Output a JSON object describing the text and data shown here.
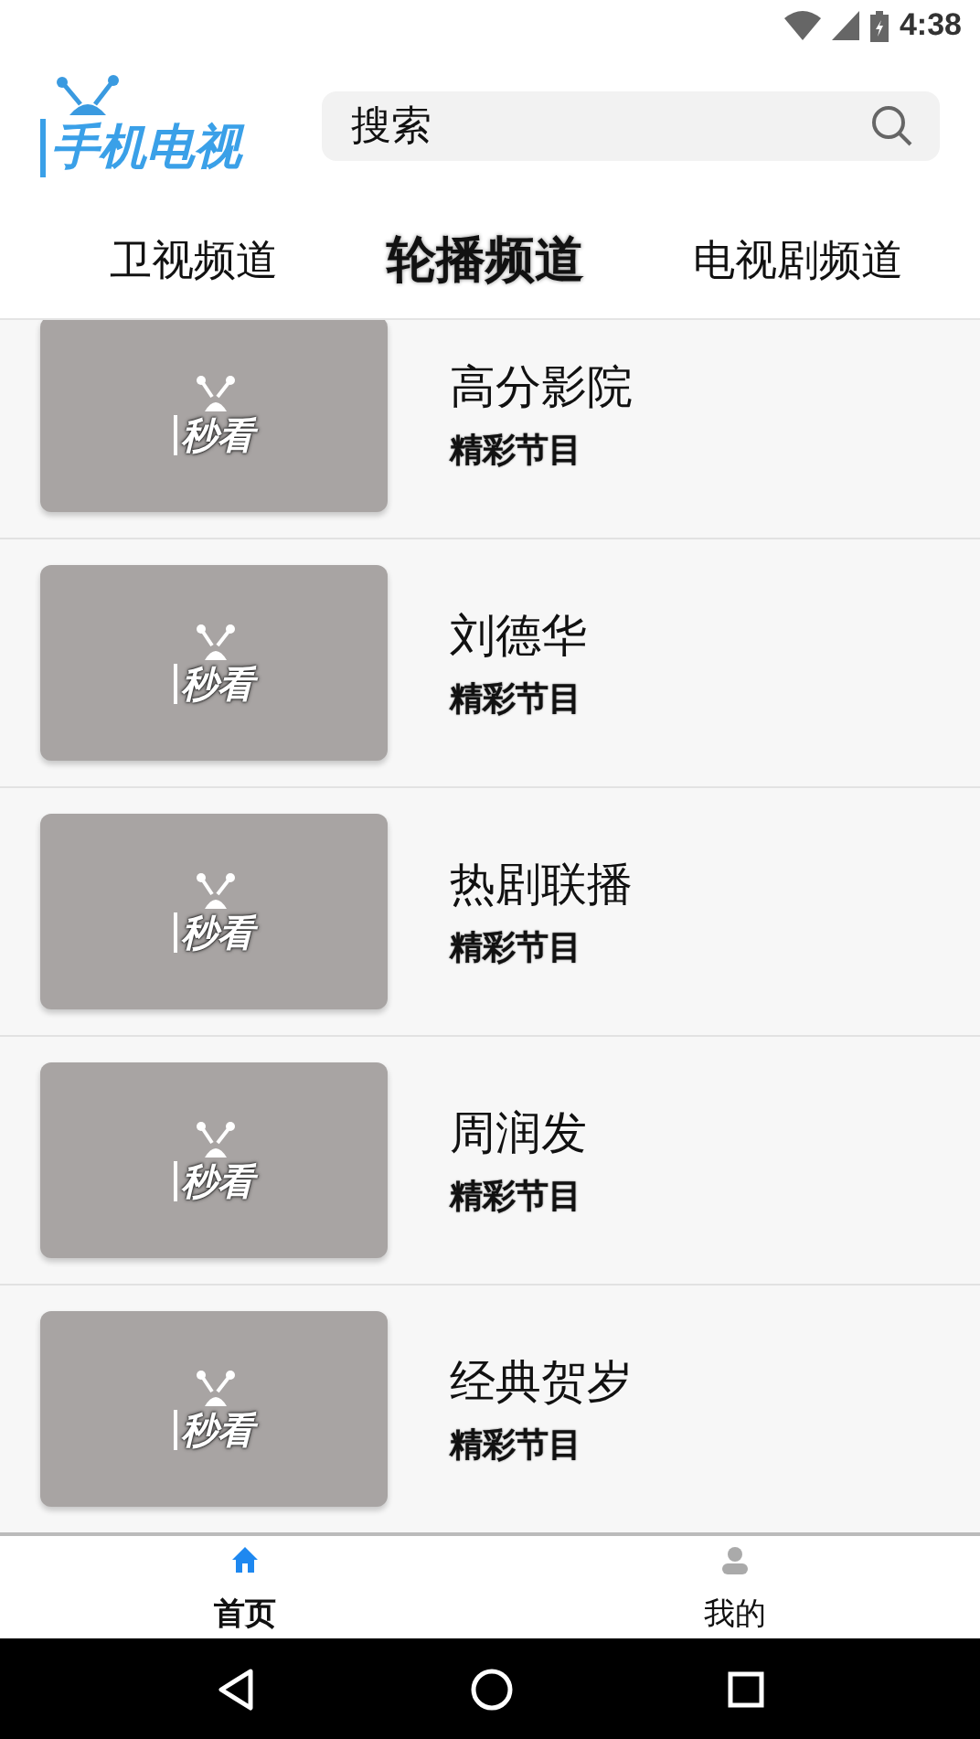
{
  "status_bar": {
    "time": "4:38"
  },
  "header": {
    "logo": "手机电视",
    "search": {
      "value": "搜索"
    }
  },
  "tabs": [
    {
      "label": "卫视频道",
      "selected": false
    },
    {
      "label": "轮播频道",
      "selected": true
    },
    {
      "label": "电视剧频道",
      "selected": false
    }
  ],
  "channels": [
    {
      "title": "高分影院",
      "subtitle": "精彩节目",
      "thumb_label": "秒看"
    },
    {
      "title": "刘德华",
      "subtitle": "精彩节目",
      "thumb_label": "秒看"
    },
    {
      "title": "热剧联播",
      "subtitle": "精彩节目",
      "thumb_label": "秒看"
    },
    {
      "title": "周润发",
      "subtitle": "精彩节目",
      "thumb_label": "秒看"
    },
    {
      "title": "经典贺岁",
      "subtitle": "精彩节目",
      "thumb_label": "秒看"
    }
  ],
  "bottom_nav": [
    {
      "label": "首页",
      "kind": "home",
      "selected": true
    },
    {
      "label": "我的",
      "kind": "person",
      "selected": false
    }
  ]
}
